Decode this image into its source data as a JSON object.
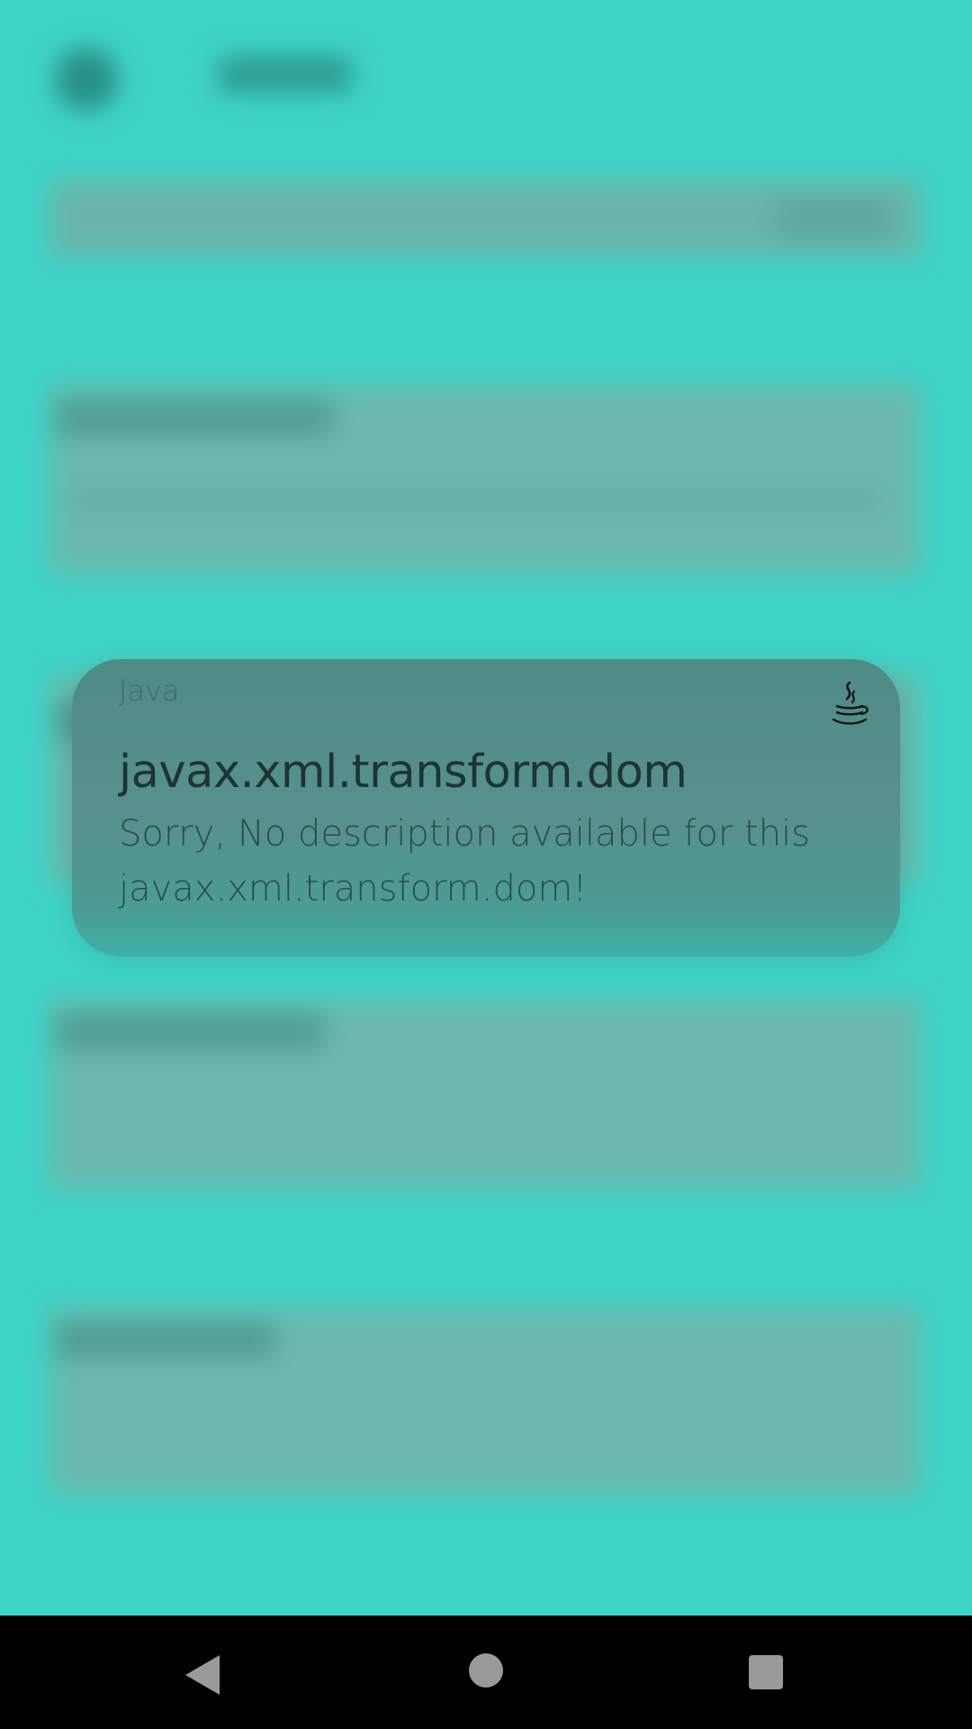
{
  "dialog": {
    "app_name": "Java",
    "app_icon": "java-coffee-cup-icon",
    "title": "javax.xml.transform.dom",
    "message": "Sorry, No description available for this javax.xml.transform.dom!"
  },
  "navbar": {
    "back_icon": "back-triangle-icon",
    "home_icon": "home-circle-icon",
    "recents_icon": "recents-square-icon"
  },
  "colors": {
    "background": "#3fd5c6",
    "dialog": "#57918b",
    "navbar": "#000000"
  }
}
